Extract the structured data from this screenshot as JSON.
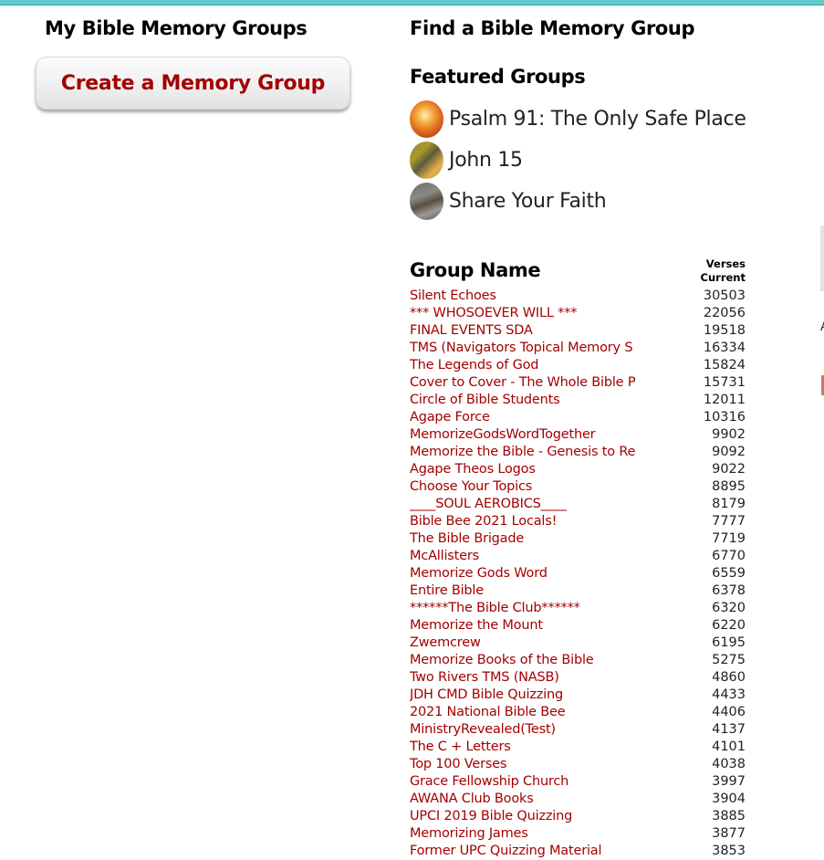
{
  "colors": {
    "topbar": "#5fcdcd",
    "link": "#a30000",
    "heading": "#000000"
  },
  "my_groups": {
    "title": "My Bible Memory Groups",
    "create_button_label": "Create a Memory Group"
  },
  "find_groups": {
    "title": "Find a Bible Memory Group",
    "featured_title": "Featured Groups",
    "featured": [
      {
        "label": "Psalm 91: The Only Safe Place",
        "icon": "sunburst-thumbnail"
      },
      {
        "label": "John 15",
        "icon": "vine-thumbnail"
      },
      {
        "label": "Share Your Faith",
        "icon": "hands-thumbnail"
      }
    ]
  },
  "table": {
    "header_name": "Group Name",
    "header_verses_line1": "Verses",
    "header_verses_line2": "Current",
    "rows": [
      {
        "name": "Silent Echoes",
        "verses": "30503"
      },
      {
        "name": "*** WHOSOEVER WILL ***",
        "verses": "22056"
      },
      {
        "name": "FINAL EVENTS SDA",
        "verses": "19518"
      },
      {
        "name": "TMS (Navigators Topical Memory S",
        "verses": "16334"
      },
      {
        "name": "The Legends of God",
        "verses": "15824"
      },
      {
        "name": "Cover to Cover - The Whole Bible P",
        "verses": "15731"
      },
      {
        "name": "Circle of Bible Students",
        "verses": "12011"
      },
      {
        "name": "Agape Force",
        "verses": "10316"
      },
      {
        "name": "MemorizeGodsWordTogether",
        "verses": "9902"
      },
      {
        "name": "Memorize the Bible - Genesis to Re",
        "verses": "9092"
      },
      {
        "name": "Agape Theos Logos",
        "verses": "9022"
      },
      {
        "name": "Choose Your Topics",
        "verses": "8895"
      },
      {
        "name": "____SOUL AEROBICS____",
        "verses": "8179"
      },
      {
        "name": "Bible Bee 2021 Locals!",
        "verses": "7777"
      },
      {
        "name": "The Bible Brigade",
        "verses": "7719"
      },
      {
        "name": "McAllisters",
        "verses": "6770"
      },
      {
        "name": "Memorize Gods Word",
        "verses": "6559"
      },
      {
        "name": "Entire Bible",
        "verses": "6378"
      },
      {
        "name": "******The Bible Club******",
        "verses": "6320"
      },
      {
        "name": "Memorize the Mount",
        "verses": "6220"
      },
      {
        "name": "Zwemcrew",
        "verses": "6195"
      },
      {
        "name": "Memorize Books of the Bible",
        "verses": "5275"
      },
      {
        "name": "Two Rivers TMS (NASB)",
        "verses": "4860"
      },
      {
        "name": "JDH CMD Bible Quizzing",
        "verses": "4433"
      },
      {
        "name": "2021 National Bible Bee",
        "verses": "4406"
      },
      {
        "name": "MinistryRevealed(Test)",
        "verses": "4137"
      },
      {
        "name": "The C + Letters",
        "verses": "4101"
      },
      {
        "name": "Top 100 Verses",
        "verses": "4038"
      },
      {
        "name": "Grace Fellowship Church",
        "verses": "3997"
      },
      {
        "name": "AWANA Club Books",
        "verses": "3904"
      },
      {
        "name": "UPCI 2019 Bible Quizzing",
        "verses": "3885"
      },
      {
        "name": "Memorizing James",
        "verses": "3877"
      },
      {
        "name": "Former UPC Quizzing Material",
        "verses": "3853"
      }
    ]
  },
  "edge": {
    "glyph": "A"
  }
}
